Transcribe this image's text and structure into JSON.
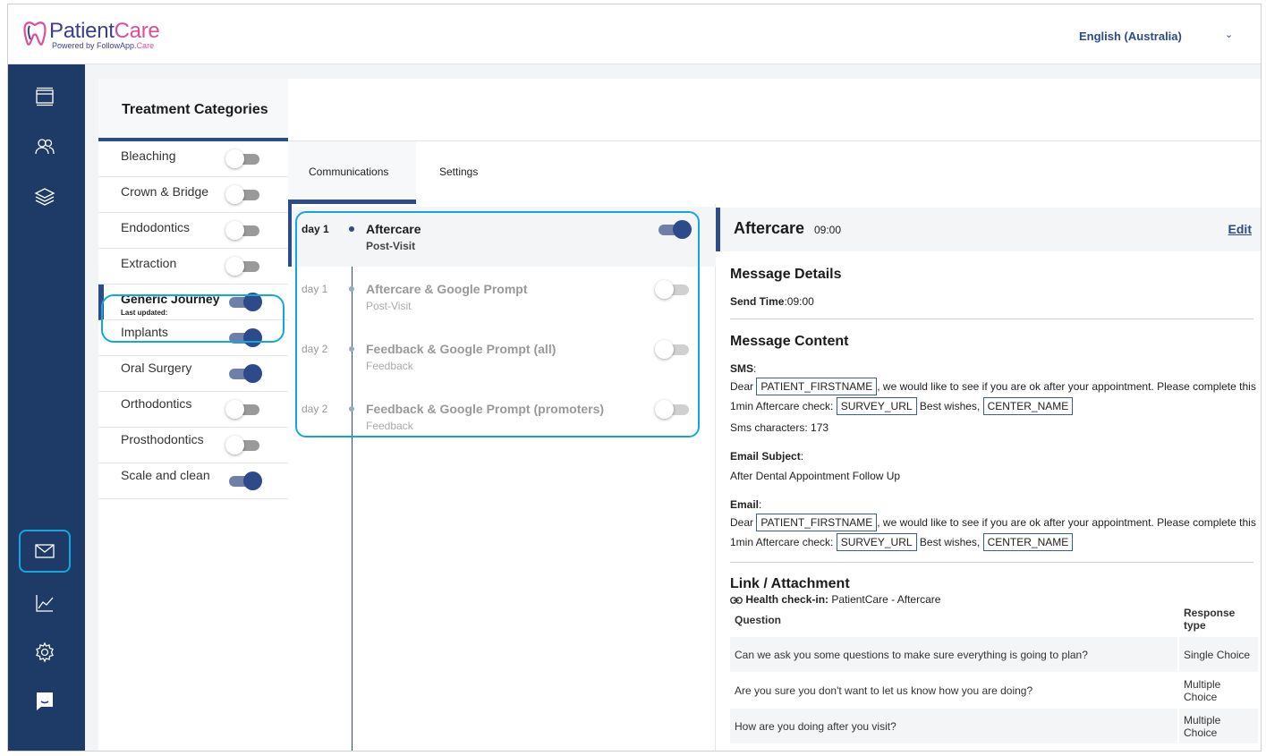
{
  "app": {
    "logo_main": "Patient",
    "logo_care": "Care",
    "logo_sub": "Powered by FollowApp.",
    "logo_sub_care": "Care",
    "language": "English (Australia)"
  },
  "sidebar": {
    "icons": [
      "dashboard-icon",
      "patients-icon",
      "layers-icon",
      "mail-icon",
      "chart-icon",
      "settings-icon",
      "chat-icon"
    ]
  },
  "categories": {
    "title": "Treatment Categories",
    "items": [
      {
        "label": "Bleaching",
        "enabled": false
      },
      {
        "label": "Crown & Bridge",
        "enabled": false
      },
      {
        "label": "Endodontics",
        "enabled": false
      },
      {
        "label": "Extraction",
        "enabled": false
      },
      {
        "label": "Generic Journey",
        "sub": "Last updated:",
        "enabled": true,
        "active": true
      },
      {
        "label": "Implants",
        "enabled": true
      },
      {
        "label": "Oral Surgery",
        "enabled": true
      },
      {
        "label": "Orthodontics",
        "enabled": false
      },
      {
        "label": "Prosthodontics",
        "enabled": false
      },
      {
        "label": "Scale and clean",
        "enabled": true
      }
    ]
  },
  "tabs": {
    "communications": "Communications",
    "settings": "Settings"
  },
  "timeline": [
    {
      "day": "day 1",
      "title": "Aftercare",
      "sub": "Post-Visit",
      "enabled": true,
      "selected": true
    },
    {
      "day": "day 1",
      "title": "Aftercare & Google Prompt",
      "sub": "Post-Visit",
      "enabled": false
    },
    {
      "day": "day 2",
      "title": "Feedback & Google Prompt (all)",
      "sub": "Feedback",
      "enabled": false
    },
    {
      "day": "day 2",
      "title": "Feedback & Google Prompt (promoters)",
      "sub": "Feedback",
      "enabled": false
    }
  ],
  "detail": {
    "title": "Aftercare",
    "time": "09:00",
    "edit": "Edit",
    "message_details": "Message Details",
    "send_time_label": "Send Time",
    "send_time_value": ":09:00",
    "message_content": "Message Content",
    "sms_label": "SMS",
    "colon": ":",
    "dear": "Dear",
    "tag_firstname": "PATIENT_FIRSTNAME",
    "body_1": ", we would like to see if you are ok after your appointment. Please complete this",
    "body_2": "1min Aftercare check:",
    "tag_survey": "SURVEY_URL",
    "best_wishes": "Best wishes,",
    "tag_center": "CENTER_NAME",
    "sms_chars": "Sms characters: 173",
    "email_subject_label": "Email Subject",
    "email_subject": "After Dental Appointment Follow Up",
    "email_label": "Email",
    "link_attachment": "Link / Attachment",
    "health_label": "Health check-in:",
    "health_value": "PatientCare - Aftercare",
    "q_header": "Question",
    "r_header": "Response type",
    "questions": [
      {
        "q": "Can we ask you some questions to make sure everything is going to plan?",
        "r": "Single Choice"
      },
      {
        "q": "Are you sure you don't want to let us know how you are doing?",
        "r": "Multiple Choice"
      },
      {
        "q": "How are you doing after you visit?",
        "r": "Multiple Choice"
      }
    ]
  },
  "colors": {
    "sidebar": "#1d3b66",
    "accent": "#2d4a8a",
    "highlight": "#12a7e0",
    "brand_pink": "#e04c9a"
  }
}
